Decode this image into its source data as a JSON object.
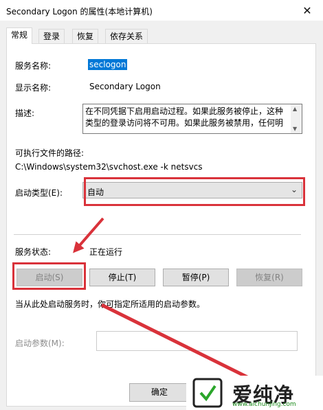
{
  "window": {
    "title": "Secondary Logon 的属性(本地计算机)",
    "close_glyph": "✕"
  },
  "tabs": [
    {
      "label": "常规",
      "active": true
    },
    {
      "label": "登录",
      "active": false
    },
    {
      "label": "恢复",
      "active": false
    },
    {
      "label": "依存关系",
      "active": false
    }
  ],
  "general": {
    "service_name_label": "服务名称:",
    "service_name_value": "seclogon",
    "display_name_label": "显示名称:",
    "display_name_value": "Secondary Logon",
    "description_label": "描述:",
    "description_line1": "在不同凭据下启用启动过程。如果此服务被停止，这种",
    "description_line2": "类型的登录访问将不可用。如果此服务被禁用，任何明",
    "exe_path_label": "可执行文件的路径:",
    "exe_path_value": "C:\\Windows\\system32\\svchost.exe -k netsvcs",
    "startup_type_label": "启动类型(E):",
    "startup_type_value": "自动",
    "status_label": "服务状态:",
    "status_value": "正在运行",
    "buttons": {
      "start": "启动(S)",
      "stop": "停止(T)",
      "pause": "暂停(P)",
      "resume": "恢复(R)"
    },
    "hint": "当从此处启动服务时，你可指定所适用的启动参数。",
    "param_label": "启动参数(M):",
    "param_value": ""
  },
  "footer": {
    "ok_label": "确定"
  },
  "watermark": {
    "brand": "爱纯净",
    "url": "www.aichunjing.com"
  },
  "colors": {
    "highlight": "#0078d7",
    "annotation_red": "#d9323a"
  }
}
